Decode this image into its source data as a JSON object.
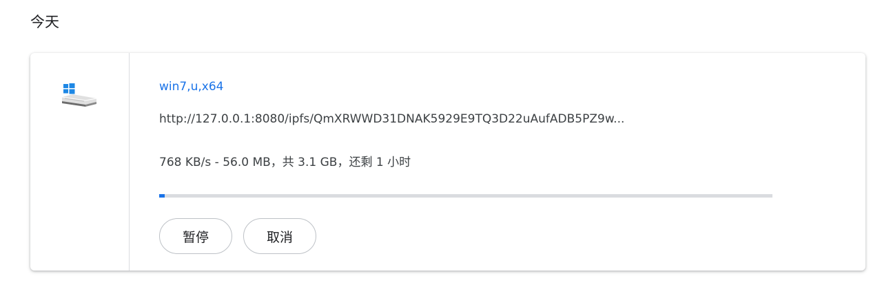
{
  "section": {
    "title": "今天"
  },
  "download": {
    "file_icon": "windows-drive-icon",
    "file_name": "win7,u,x64",
    "url": "http://127.0.0.1:8080/ipfs/QmXRWWD31DNAK5929E9TQ3D22uAufADB5PZ9w...",
    "status": "768 KB/s - 56.0 MB，共 3.1 GB，还剩 1 小时",
    "progress_fraction": 0.009,
    "buttons": {
      "pause": "暂停",
      "cancel": "取消"
    }
  },
  "colors": {
    "accent": "#1a73e8",
    "progress_track": "#dadce0",
    "text": "#3c4043"
  }
}
